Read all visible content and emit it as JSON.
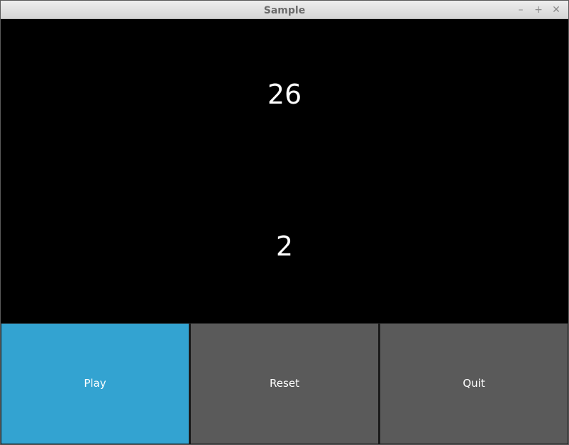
{
  "window": {
    "title": "Sample",
    "minimize_glyph": "–",
    "maximize_glyph": "+",
    "close_glyph": "✕"
  },
  "display": {
    "top_value": "26",
    "bottom_value": "2"
  },
  "buttons": {
    "play": {
      "label": "Play",
      "color": "#33a3d1"
    },
    "reset": {
      "label": "Reset",
      "color": "#5a5a5a"
    },
    "quit": {
      "label": "Quit",
      "color": "#5a5a5a"
    }
  },
  "icons": {
    "minimize": "minimize-icon",
    "maximize": "maximize-icon",
    "close": "close-icon"
  }
}
